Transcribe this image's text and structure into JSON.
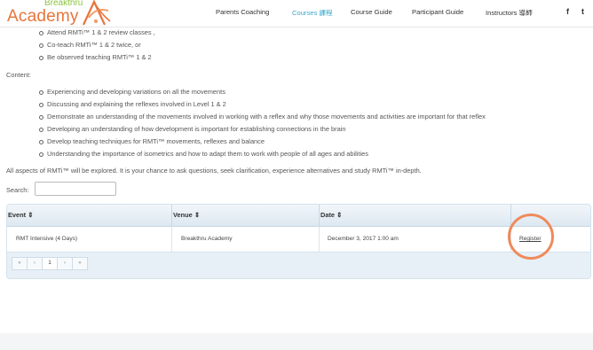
{
  "header": {
    "logo_top": "Breakthru",
    "logo_main": "Academy",
    "nav": [
      {
        "label": "Parents Coaching"
      },
      {
        "label": "Courses 課程"
      },
      {
        "label": "Course Guide"
      },
      {
        "label": "Participant Guide"
      },
      {
        "label": "Instructors 導師"
      }
    ],
    "social": [
      "f",
      "t"
    ]
  },
  "requirements": [
    "Attend RMTi™ 1 & 2 review classes ,",
    "Co-teach RMTi™ 1 & 2 twice, or",
    "Be observed teaching RMTi™ 1 & 2"
  ],
  "content_heading": "Content:",
  "content_items": [
    "Experiencing and developing variations on all the movements",
    "Discussing and explaining the reflexes involved in Level 1 & 2",
    "Demonstrate an understanding of the movements involved in working with a reflex and why those movements and activities are important for that reflex",
    "Developing an understanding of how development is important for establishing connections in the brain",
    "Develop teaching techniques for RMTi™ movements, reflexes and balance",
    "Understanding the importance of isometrics and how to adapt them to work with people of all ages and abilities"
  ],
  "summary": "All aspects of RMTi™ will be explored. It is your chance to ask questions, seek clarification, experience alternatives and study RMTi™ in-depth.",
  "search": {
    "label": "Search:",
    "value": ""
  },
  "table": {
    "headers": [
      "Event",
      "Venue",
      "Date"
    ],
    "sort_glyph": "⇕",
    "rows": [
      {
        "event": "RMT Intensive (4 Days)",
        "venue": "Breakthru Academy",
        "date": "December 3, 2017 1:00 am",
        "action": "Register"
      }
    ],
    "pagination": {
      "first": "«",
      "prev": "‹",
      "current": "1",
      "next": "›",
      "last": "»"
    }
  },
  "colors": {
    "accent": "#3aa7c9",
    "brand_orange": "#e8743b",
    "brand_green": "#8cc43e",
    "highlight_ring": "#ef8a5b"
  }
}
